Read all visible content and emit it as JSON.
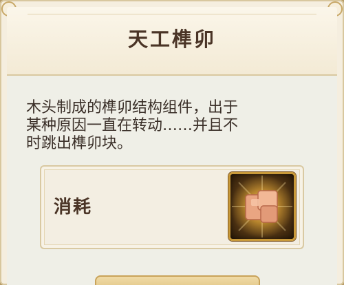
{
  "dialog": {
    "title": "天工榫卯",
    "description_lines": [
      "木头制成的榫卯结构组件，出于",
      "某种原因一直在转动……并且不",
      "时跳出榫卯块。"
    ],
    "consume": {
      "label": "消耗",
      "item_icon": "tenon-block-icon"
    }
  },
  "colors": {
    "title_text": "#4a3426",
    "panel_bg": "#f5eedf",
    "slot_border": "#c99a3a"
  }
}
